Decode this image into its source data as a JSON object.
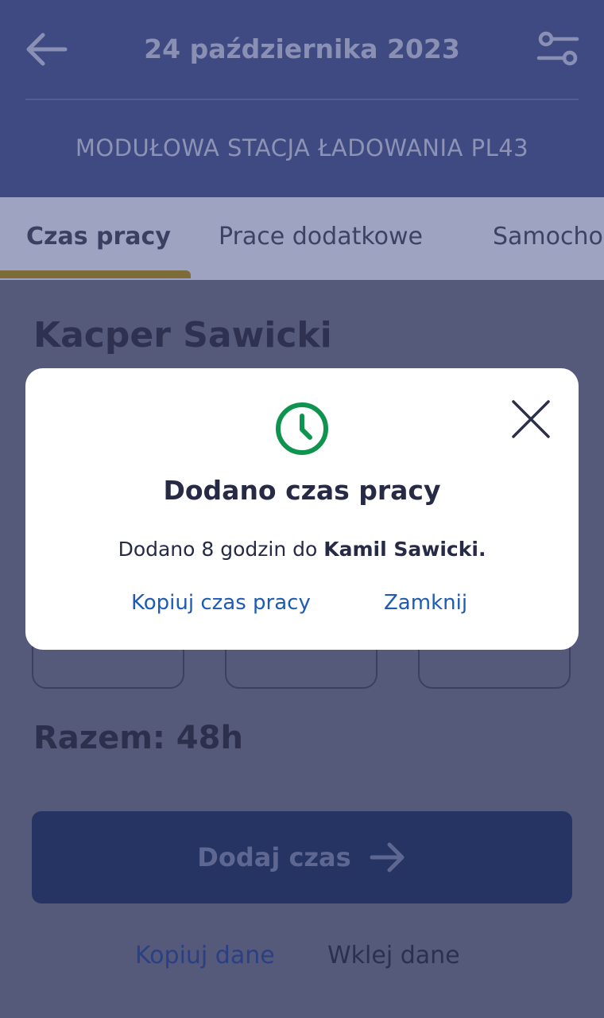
{
  "header": {
    "title": "24 października 2023",
    "back_icon": "arrow-left-icon",
    "filter_icon": "sliders-icon",
    "station": "MODUŁOWA STACJA ŁADOWANIA PL43",
    "background": "#404a82"
  },
  "tabs": [
    {
      "label": "Czas pracy",
      "active": true
    },
    {
      "label": "Prace dodatkowe",
      "active": false
    },
    {
      "label": "Samocho",
      "active": false
    }
  ],
  "content": {
    "worker_name": "Kacper Sawicki",
    "total": "Razem: 48h",
    "add_button_label": "Dodaj czas",
    "add_button_icon": "arrow-right-icon",
    "copy_label": "Kopiuj dane",
    "paste_label": "Wklej dane"
  },
  "modal": {
    "icon": "clock-icon",
    "icon_color": "#0f9450",
    "close_icon": "close-icon",
    "title": "Dodano czas pracy",
    "message_prefix": "Dodano 8 godzin do ",
    "message_name": "Kamil Sawicki.",
    "copy_action": "Kopiuj czas pracy",
    "close_action": "Zamknij",
    "action_color": "#1d5bb5"
  }
}
